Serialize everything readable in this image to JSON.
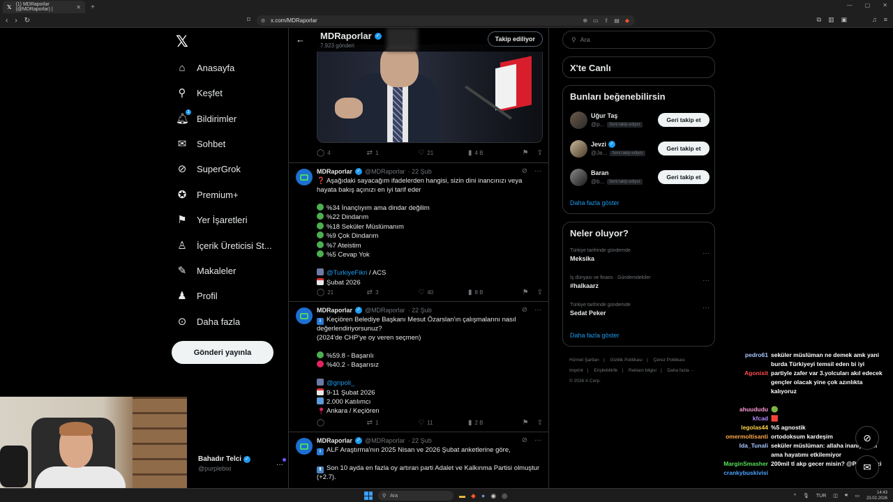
{
  "browser": {
    "tab_title": "(1) MDRaporlar (@MDRaporlar) |",
    "tab_icon": "x-logo-icon",
    "url": "x.com/MDRaporlar"
  },
  "nav": {
    "items": [
      {
        "label": "Anasayfa",
        "icon": "home-icon"
      },
      {
        "label": "Keşfet",
        "icon": "search-icon"
      },
      {
        "label": "Bildirimler",
        "icon": "bell-icon",
        "badge": "1"
      },
      {
        "label": "Sohbet",
        "icon": "mail-icon"
      },
      {
        "label": "SuperGrok",
        "icon": "grok-icon"
      },
      {
        "label": "Premium+",
        "icon": "premium-icon"
      },
      {
        "label": "Yer İşaretleri",
        "icon": "bookmark-icon"
      },
      {
        "label": "İçerik Üreticisi St...",
        "icon": "creator-studio-icon"
      },
      {
        "label": "Makaleler",
        "icon": "articles-icon"
      },
      {
        "label": "Profil",
        "icon": "person-icon"
      },
      {
        "label": "Daha fazla",
        "icon": "more-circle-icon"
      }
    ],
    "post_button": "Gönderi yayınla",
    "account": {
      "name": "Bahadır Telci",
      "handle": "@purplebixi"
    }
  },
  "profile_header": {
    "name": "MDRaporlar",
    "posts": "7.923 gönderi",
    "follow_button": "Takip ediliyor"
  },
  "tweets": [
    {
      "stats": {
        "replies": "4",
        "retweets": "1",
        "likes": "21",
        "views": "4 B"
      }
    },
    {
      "name": "MDRaporlar",
      "handle": "@MDRaporlar",
      "date": "· 22 Şub",
      "lines": [
        "❓ Aşağıdaki sayacağım ifadelerden hangisi, sizin dini inancınızı veya",
        "hayata bakış açınızı en iyi tarif eder",
        "",
        "%34 İnançlıyım ama dindar değilim",
        "%22 Dindarım",
        "%18 Seküler Müslümanım",
        "%9 Çok Dindarım",
        "%7 Ateistim",
        "%5 Cevap Yok",
        "",
        "@TurkiyeFikri",
        " / ACS",
        "Şubat 2026"
      ],
      "stats": {
        "replies": "21",
        "retweets": "3",
        "likes": "40",
        "views": "8 B"
      }
    },
    {
      "name": "MDRaporlar",
      "handle": "@MDRaporlar",
      "date": "· 22 Şub",
      "lines": [
        "Keçiören Belediye Başkanı Mesut Özarslan'ın çalışmalarını nasıl",
        "değerlendiriyorsunuz?",
        "(2024'de CHP'ye oy veren seçmen)",
        "",
        "%59.8 - Başarılı",
        "%40.2 - Başarısız",
        "",
        "@gripoli_",
        "9-11 Şubat 2026",
        "2.000 Katılımcı",
        "Ankara / Keçiören"
      ],
      "stats": {
        "replies": "",
        "retweets": "1",
        "likes": "11",
        "views": "2 B"
      }
    },
    {
      "name": "MDRaporlar",
      "handle": "@MDRaporlar",
      "date": "· 22 Şub",
      "lines": [
        "ALF Araştırma'nın 2025 Nisan ve 2026 Şubat anketlerine göre,",
        "",
        "Son 10 ayda en fazla oy artıran parti Adalet ve Kalkınma Partisi olmuştur",
        "(+2.7)."
      ]
    }
  ],
  "right": {
    "search_placeholder": "Ara",
    "live_title": "X'te Canlı",
    "suggest_title": "Bunları beğenebilirsin",
    "suggestions": [
      {
        "name": "Uğur Taş",
        "handle": "@p...",
        "tag": "Seni takip ediyor",
        "button": "Geri takip et",
        "verified": false
      },
      {
        "name": "Jevzi",
        "handle": "@Je...",
        "tag": "Seni takip ediyor",
        "button": "Geri takip et",
        "verified": true
      },
      {
        "name": "Baran",
        "handle": "@b...",
        "tag": "Seni takip ediyor",
        "button": "Geri takip et",
        "verified": false
      }
    ],
    "show_more": "Daha fazla göster",
    "trends_title": "Neler oluyor?",
    "trends": [
      {
        "context": "Türkiye tarihinde gündemde",
        "name": "Meksika"
      },
      {
        "context": "İş dünyası ve finans · Gündemdekiler",
        "name": "#halkaarz"
      },
      {
        "context": "Türkiye tarihinde gündemde",
        "name": "Sedat Peker"
      }
    ],
    "trends_more": "Daha fazla göster",
    "footer": [
      "Hizmet Şartları",
      "|",
      "Gizlilik Politikası",
      "|",
      "Çerez Politikası",
      "|",
      "Imprint",
      "|",
      "Erişilebilirlik",
      "|",
      "Reklam bilgisi",
      "|",
      "Daha fazla ···",
      "© 2026 X Corp."
    ]
  },
  "chat": [
    {
      "user": "pedro61",
      "color": "#a7c7ff",
      "text": "seküler müslüman ne demek amk yani burda Türkiyeyi temsil eden bi iyi partiyle zafer var 3.yolcuları akıl edecek gençler olacak yine çok azınlıkta kalıyoruz"
    },
    {
      "user": "Agonixit",
      "color": "#ff4d4d",
      "text": ""
    },
    {
      "user": "ahuududu",
      "color": "#ff9ad5",
      "text": "🟢"
    },
    {
      "user": "kfcad",
      "color": "#b48cff",
      "text": "🟥"
    },
    {
      "user": "legolas44",
      "color": "#ffd54a",
      "text": "%5 agnostik"
    },
    {
      "user": "omermoltisanti",
      "color": "#ffa94d",
      "text": "ortodoksum kardeşim"
    },
    {
      "user": "Ida_Tunali",
      "color": "#a7c7ff",
      "text": "seküler müslüman: allaha inanıyorum ama hayatımı etkilemiyor"
    },
    {
      "user": "MarginSmasher",
      "color": "#58e05a",
      "text": "200mil tl akp gecer misin? @PurpleBixi"
    },
    {
      "user": "crankybuskivisi",
      "color": "#4aa3ff",
      "text": ""
    }
  ],
  "taskbar": {
    "search": "Ara",
    "lang": "TUR",
    "time": "14:43",
    "date": "23.02.2026"
  }
}
